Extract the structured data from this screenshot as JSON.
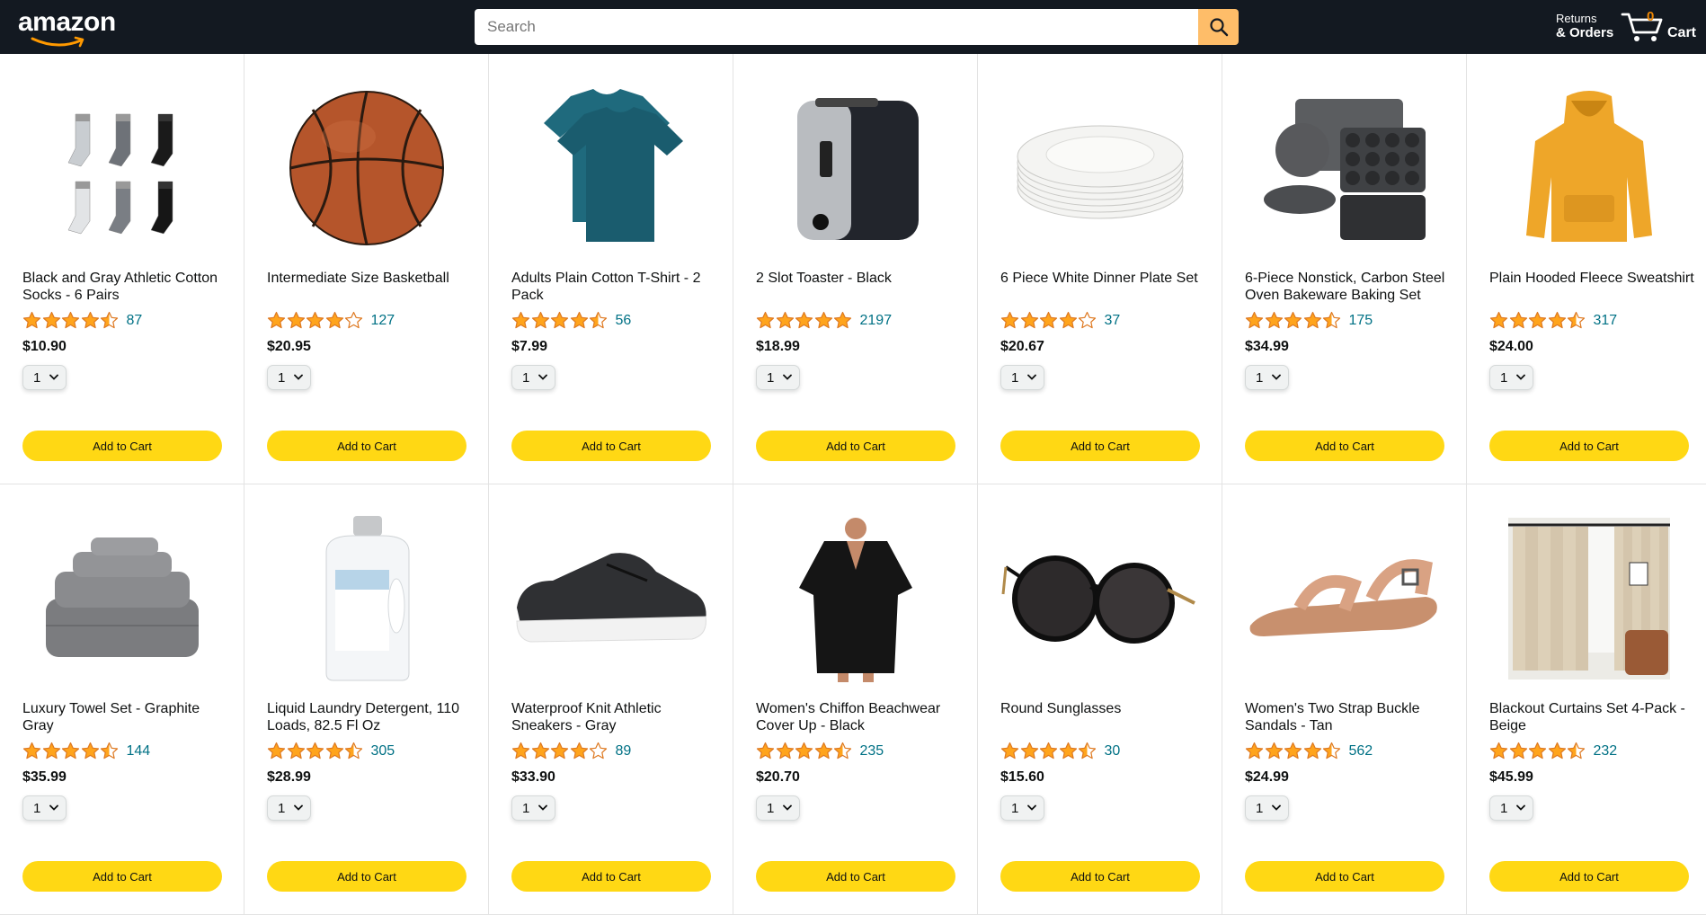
{
  "header": {
    "logo_text": "amazon",
    "search_placeholder": "Search",
    "returns_line1": "Returns",
    "returns_line2": "& Orders",
    "cart_count": "0",
    "cart_label": "Cart"
  },
  "colors": {
    "header_bg": "#131921",
    "search_button": "#febd69",
    "star": "#ffa41c",
    "link": "#007185",
    "add_to_cart": "#ffd814",
    "cart_count": "#f08804"
  },
  "add_to_cart_label": "Add to Cart",
  "products": [
    {
      "title": "Black and Gray Athletic Cotton Socks - 6 Pairs",
      "rating": 4.5,
      "count": "87",
      "price": "$10.90",
      "qty": "1",
      "image": "socks-image"
    },
    {
      "title": "Intermediate Size Basketball",
      "rating": 4.0,
      "count": "127",
      "price": "$20.95",
      "qty": "1",
      "image": "basketball-image"
    },
    {
      "title": "Adults Plain Cotton T-Shirt - 2 Pack",
      "rating": 4.5,
      "count": "56",
      "price": "$7.99",
      "qty": "1",
      "image": "tshirt-image"
    },
    {
      "title": "2 Slot Toaster - Black",
      "rating": 5.0,
      "count": "2197",
      "price": "$18.99",
      "qty": "1",
      "image": "toaster-image"
    },
    {
      "title": "6 Piece White Dinner Plate Set",
      "rating": 4.0,
      "count": "37",
      "price": "$20.67",
      "qty": "1",
      "image": "plates-image"
    },
    {
      "title": "6-Piece Nonstick, Carbon Steel Oven Bakeware Baking Set",
      "rating": 4.5,
      "count": "175",
      "price": "$34.99",
      "qty": "1",
      "image": "bakeware-image"
    },
    {
      "title": "Plain Hooded Fleece Sweatshirt",
      "rating": 4.5,
      "count": "317",
      "price": "$24.00",
      "qty": "1",
      "image": "hoodie-image"
    },
    {
      "title": "Luxury Towel Set - Graphite Gray",
      "rating": 4.5,
      "count": "144",
      "price": "$35.99",
      "qty": "1",
      "image": "towels-image"
    },
    {
      "title": "Liquid Laundry Detergent, 110 Loads, 82.5 Fl Oz",
      "rating": 4.5,
      "count": "305",
      "price": "$28.99",
      "qty": "1",
      "image": "detergent-image"
    },
    {
      "title": "Waterproof Knit Athletic Sneakers - Gray",
      "rating": 4.0,
      "count": "89",
      "price": "$33.90",
      "qty": "1",
      "image": "sneaker-image"
    },
    {
      "title": "Women's Chiffon Beachwear Cover Up - Black",
      "rating": 4.5,
      "count": "235",
      "price": "$20.70",
      "qty": "1",
      "image": "coverup-image"
    },
    {
      "title": "Round Sunglasses",
      "rating": 4.5,
      "count": "30",
      "price": "$15.60",
      "qty": "1",
      "image": "sunglasses-image"
    },
    {
      "title": "Women's Two Strap Buckle Sandals - Tan",
      "rating": 4.5,
      "count": "562",
      "price": "$24.99",
      "qty": "1",
      "image": "sandal-image"
    },
    {
      "title": "Blackout Curtains Set 4-Pack - Beige",
      "rating": 4.5,
      "count": "232",
      "price": "$45.99",
      "qty": "1",
      "image": "curtains-image"
    }
  ]
}
